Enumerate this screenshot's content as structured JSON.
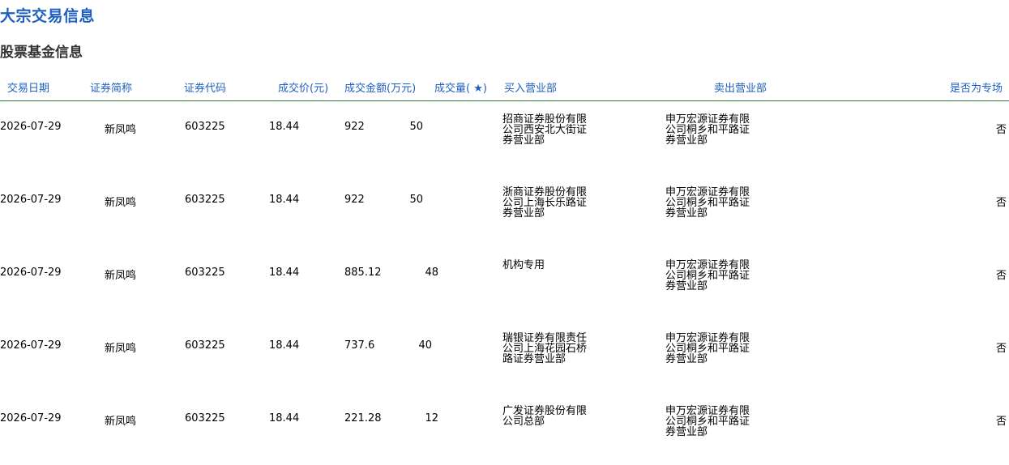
{
  "page": {
    "title": "大宗交易信息",
    "section_title": "股票基金信息"
  },
  "table": {
    "headers": {
      "date": "交易日期",
      "name": "证券简称",
      "code": "证券代码",
      "price": "成交价(元)",
      "amount": "成交金额(万元)",
      "volume": "成交量( ★)",
      "buy": "买入营业部",
      "sell": "卖出营业部",
      "special": "是否为专场"
    },
    "rows": [
      {
        "date": "2026-07-29",
        "name": "新凤鸣",
        "code": "603225",
        "price": "18.44",
        "amount": "922",
        "volume": "50",
        "buy": "招商证券股份有限公司西安北大街证券营业部",
        "sell": "申万宏源证券有限公司桐乡和平路证券营业部",
        "special": "否"
      },
      {
        "date": "2026-07-29",
        "name": "新凤鸣",
        "code": "603225",
        "price": "18.44",
        "amount": "922",
        "volume": "50",
        "buy": "浙商证券股份有限公司上海长乐路证券营业部",
        "sell": "申万宏源证券有限公司桐乡和平路证券营业部",
        "special": "否"
      },
      {
        "date": "2026-07-29",
        "name": "新凤鸣",
        "code": "603225",
        "price": "18.44",
        "amount": "885.12",
        "volume": "48",
        "buy": "机构专用",
        "sell": "申万宏源证券有限公司桐乡和平路证券营业部",
        "special": "否"
      },
      {
        "date": "2026-07-29",
        "name": "新凤鸣",
        "code": "603225",
        "price": "18.44",
        "amount": "737.6",
        "volume": "40",
        "buy": "瑞银证券有限责任公司上海花园石桥路证券营业部",
        "sell": "申万宏源证券有限公司桐乡和平路证券营业部",
        "special": "否"
      },
      {
        "date": "2026-07-29",
        "name": "新凤鸣",
        "code": "603225",
        "price": "18.44",
        "amount": "221.28",
        "volume": "12",
        "buy": "广发证券股份有限公司总部",
        "sell": "申万宏源证券有限公司桐乡和平路证券营业部",
        "special": "否"
      }
    ]
  }
}
